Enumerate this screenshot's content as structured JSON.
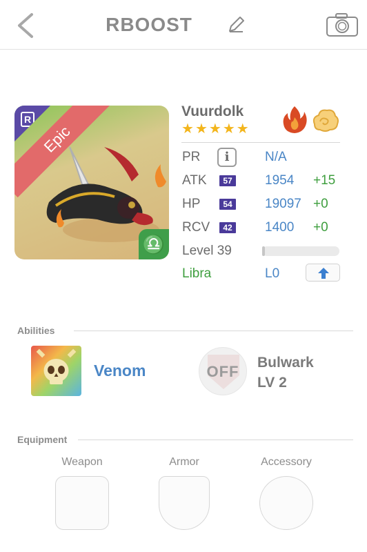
{
  "header": {
    "title": "RBOOST",
    "back_icon": "chevron-left-icon",
    "edit_icon": "pencil-icon",
    "camera_icon": "camera-icon"
  },
  "card": {
    "rarity": "Epic",
    "rarity_badge": "R",
    "zodiac_symbol": "♎",
    "accent_colors": {
      "ribbon": "#e26a6a",
      "rarity_badge": "#5a4aa6",
      "zodiac_badge": "#3f9e4a"
    }
  },
  "monster": {
    "name": "Vuurdolk",
    "stars": 5,
    "elements": [
      "fire-element-icon",
      "wind-element-icon"
    ]
  },
  "stats": {
    "pr": {
      "label": "PR",
      "value": "N/A"
    },
    "atk": {
      "label": "ATK",
      "badge": "57",
      "value": "1954",
      "bonus": "+15"
    },
    "hp": {
      "label": "HP",
      "badge": "54",
      "value": "19097",
      "bonus": "+0"
    },
    "rcv": {
      "label": "RCV",
      "badge": "42",
      "value": "1400",
      "bonus": "+0"
    },
    "level": {
      "label": "Level 39",
      "progress": 0.01
    },
    "zodiac": {
      "label": "Libra",
      "level": "L0"
    }
  },
  "abilities": {
    "section_label": "Abilities",
    "items": [
      {
        "name": "Venom",
        "icon": "skull-icon"
      },
      {
        "name": "Bulwark",
        "level": "LV 2",
        "state": "OFF",
        "icon": "shield-icon"
      }
    ]
  },
  "equipment": {
    "section_label": "Equipment",
    "slots": [
      {
        "label": "Weapon"
      },
      {
        "label": "Armor"
      },
      {
        "label": "Accessory"
      }
    ]
  }
}
